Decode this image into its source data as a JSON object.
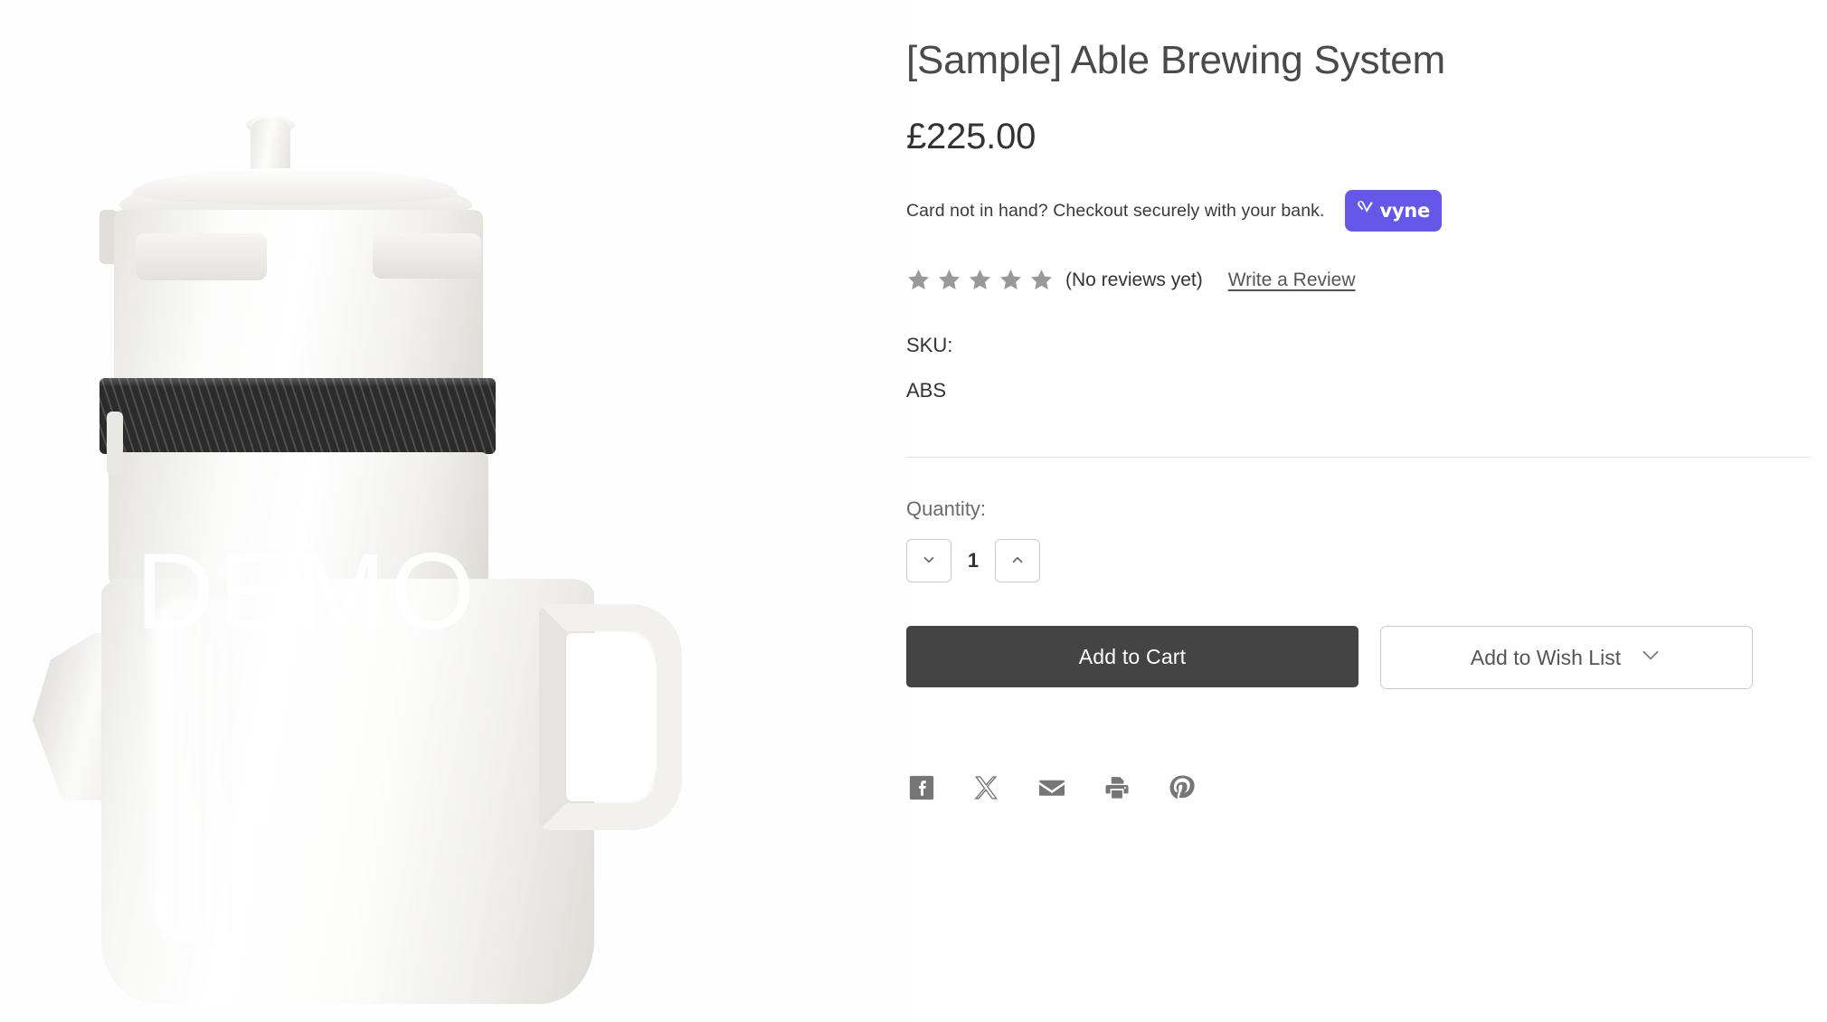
{
  "product": {
    "title": "[Sample] Able Brewing System",
    "price": "£225.00",
    "sku_label": "SKU:",
    "sku_value": "ABS",
    "watermark": "DEMO"
  },
  "payment": {
    "prompt": "Card not in hand? Checkout securely with your bank.",
    "provider_name": "vyne",
    "provider_color": "#6558e8",
    "provider_icon": "vyne-heart-check-icon"
  },
  "reviews": {
    "rating": 0,
    "star_count": 5,
    "star_color": "#999999",
    "summary": "(No reviews yet)",
    "write_link": "Write a Review"
  },
  "purchase": {
    "quantity_label": "Quantity:",
    "quantity_value": "1",
    "decrement_icon": "chevron-down-icon",
    "increment_icon": "chevron-up-icon",
    "add_to_cart_label": "Add to Cart",
    "add_to_cart_color": "#444444",
    "wish_list_label": "Add to Wish List",
    "wish_list_icon": "chevron-down-icon"
  },
  "share": {
    "items": [
      {
        "name": "facebook-icon",
        "label": "Facebook"
      },
      {
        "name": "x-twitter-icon",
        "label": "X"
      },
      {
        "name": "email-icon",
        "label": "Email"
      },
      {
        "name": "print-icon",
        "label": "Print"
      },
      {
        "name": "pinterest-icon",
        "label": "Pinterest"
      }
    ],
    "icon_color": "#767676"
  }
}
